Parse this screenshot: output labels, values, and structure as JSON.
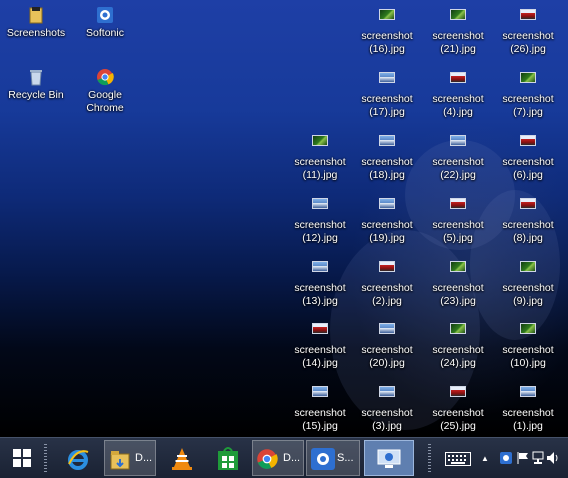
{
  "desktop": {
    "icons": {
      "screenshots": "Screenshots",
      "softonic": "Softonic",
      "recycle_bin": "Recycle Bin",
      "chrome_line1": "Google",
      "chrome_line2": "Chrome"
    },
    "files": [
      {
        "id": "f16",
        "l1": "screenshot",
        "l2": "(16).jpg",
        "thumb": "green"
      },
      {
        "id": "f21",
        "l1": "screenshot",
        "l2": "(21).jpg",
        "thumb": "green"
      },
      {
        "id": "f26",
        "l1": "screenshot",
        "l2": "(26).jpg",
        "thumb": "red"
      },
      {
        "id": "f17",
        "l1": "screenshot",
        "l2": "(17).jpg",
        "thumb": "blue"
      },
      {
        "id": "f4",
        "l1": "screenshot",
        "l2": "(4).jpg",
        "thumb": "red"
      },
      {
        "id": "f7",
        "l1": "screenshot",
        "l2": "(7).jpg",
        "thumb": "green"
      },
      {
        "id": "f11",
        "l1": "screenshot",
        "l2": "(11).jpg",
        "thumb": "green"
      },
      {
        "id": "f18",
        "l1": "screenshot",
        "l2": "(18).jpg",
        "thumb": "blue"
      },
      {
        "id": "f22",
        "l1": "screenshot",
        "l2": "(22).jpg",
        "thumb": "blue"
      },
      {
        "id": "f6",
        "l1": "screenshot",
        "l2": "(6).jpg",
        "thumb": "red"
      },
      {
        "id": "f12",
        "l1": "screenshot",
        "l2": "(12).jpg",
        "thumb": "blue"
      },
      {
        "id": "f19",
        "l1": "screenshot",
        "l2": "(19).jpg",
        "thumb": "blue"
      },
      {
        "id": "f5",
        "l1": "screenshot",
        "l2": "(5).jpg",
        "thumb": "red"
      },
      {
        "id": "f8",
        "l1": "screenshot",
        "l2": "(8).jpg",
        "thumb": "red"
      },
      {
        "id": "f13",
        "l1": "screenshot",
        "l2": "(13).jpg",
        "thumb": "blue"
      },
      {
        "id": "f2",
        "l1": "screenshot",
        "l2": "(2).jpg",
        "thumb": "red"
      },
      {
        "id": "f23",
        "l1": "screenshot",
        "l2": "(23).jpg",
        "thumb": "green"
      },
      {
        "id": "f9",
        "l1": "screenshot",
        "l2": "(9).jpg",
        "thumb": "green"
      },
      {
        "id": "f14",
        "l1": "screenshot",
        "l2": "(14).jpg",
        "thumb": "red"
      },
      {
        "id": "f20",
        "l1": "screenshot",
        "l2": "(20).jpg",
        "thumb": "blue"
      },
      {
        "id": "f24",
        "l1": "screenshot",
        "l2": "(24).jpg",
        "thumb": "green"
      },
      {
        "id": "f10",
        "l1": "screenshot",
        "l2": "(10).jpg",
        "thumb": "green"
      },
      {
        "id": "f15",
        "l1": "screenshot",
        "l2": "(15).jpg",
        "thumb": "blue"
      },
      {
        "id": "f3",
        "l1": "screenshot",
        "l2": "(3).jpg",
        "thumb": "blue"
      },
      {
        "id": "f25",
        "l1": "screenshot",
        "l2": "(25).jpg",
        "thumb": "red"
      },
      {
        "id": "f1",
        "l1": "screenshot",
        "l2": "(1).jpg",
        "thumb": "blue"
      }
    ]
  },
  "taskbar": {
    "explorer_label": "D...",
    "chrome_label": "D...",
    "softonic_label": "S...",
    "tray_chevron": "▲"
  },
  "colors": {
    "green_thumb": "#2f7a1d",
    "red_thumb": "#c02020",
    "blue_thumb": "#5b88c8"
  }
}
